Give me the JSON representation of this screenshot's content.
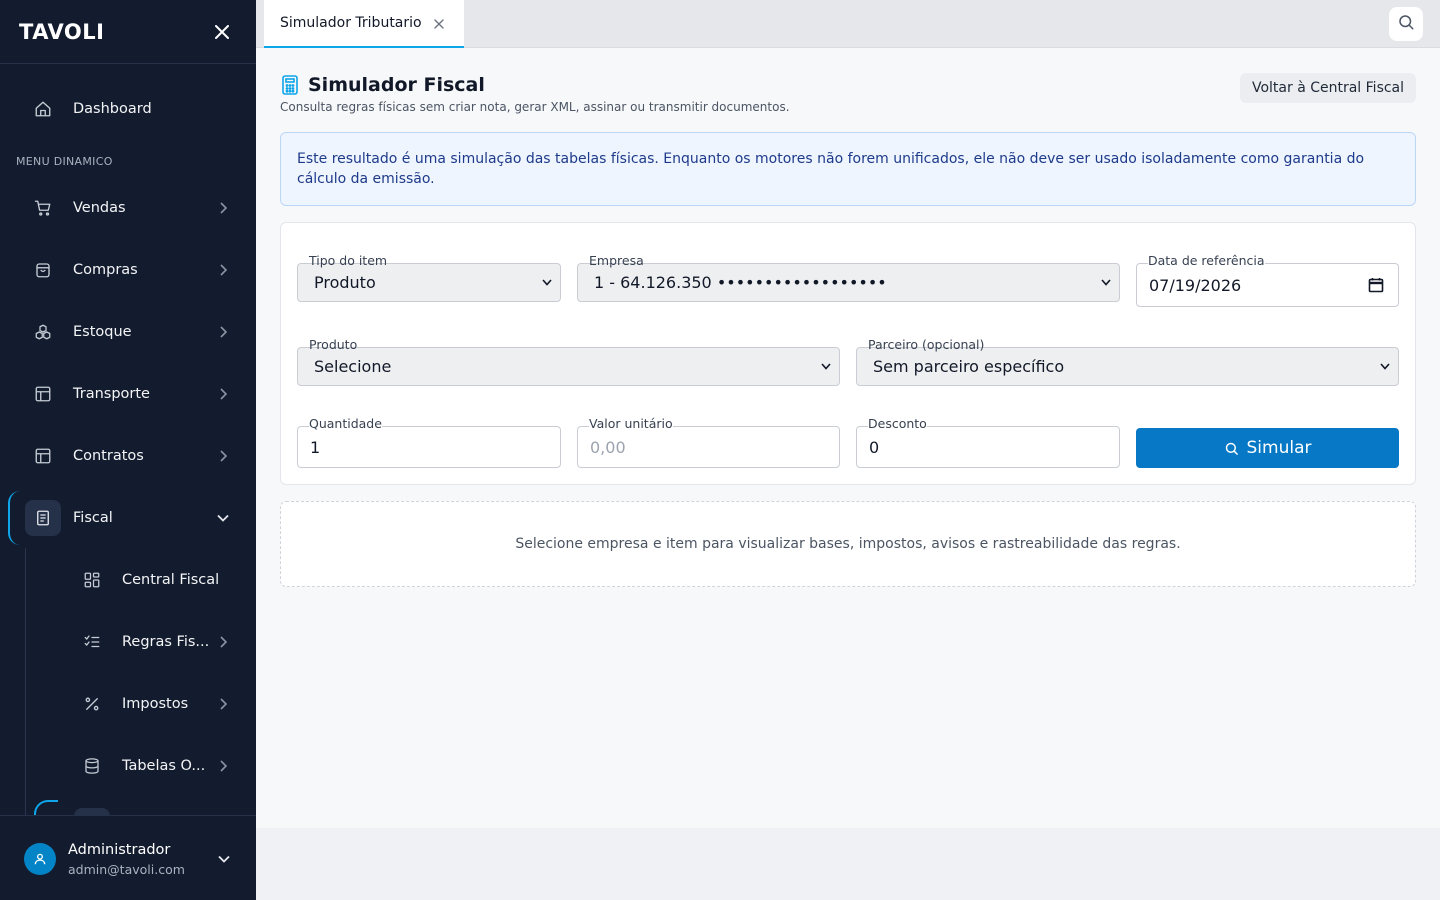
{
  "sidebar": {
    "logo": "TAVOLI",
    "dashboard_label": "Dashboard",
    "section_label": "MENU DINAMICO",
    "items": [
      {
        "label": "Vendas",
        "icon": "cart-icon"
      },
      {
        "label": "Compras",
        "icon": "bag-icon"
      },
      {
        "label": "Estoque",
        "icon": "boxes-icon"
      },
      {
        "label": "Transporte",
        "icon": "layout-icon"
      },
      {
        "label": "Contratos",
        "icon": "layout-icon"
      },
      {
        "label": "Fiscal",
        "icon": "document-icon"
      }
    ],
    "fiscal_sub": [
      {
        "label": "Central Fiscal",
        "icon": "grid-icon"
      },
      {
        "label": "Regras Fis...",
        "icon": "checklist-icon"
      },
      {
        "label": "Impostos",
        "icon": "percent-icon"
      },
      {
        "label": "Tabelas O...",
        "icon": "database-icon"
      }
    ],
    "user": {
      "name": "Administrador",
      "email": "admin@tavoli.com"
    }
  },
  "tabs": [
    {
      "label": "Simulador Tributario"
    }
  ],
  "page": {
    "title": "Simulador Fiscal",
    "subtitle": "Consulta regras físicas sem criar nota, gerar XML, assinar ou transmitir documentos.",
    "back_button": "Voltar à Central Fiscal",
    "notice": "Este resultado é uma simulação das tabelas físicas. Enquanto os motores não forem unificados, ele não deve ser usado isoladamente como garantia do cálculo da emissão."
  },
  "form": {
    "tipo_label": "Tipo do item",
    "tipo_value": "Produto",
    "empresa_label": "Empresa",
    "empresa_value": "1 - 64.126.350 ••••••••••••••••••",
    "data_label": "Data de referência",
    "data_value": "07/19/2026",
    "produto_label": "Produto",
    "produto_value": "Selecione",
    "parceiro_label": "Parceiro (opcional)",
    "parceiro_value": "Sem parceiro específico",
    "quantidade_label": "Quantidade",
    "quantidade_value": "1",
    "valor_label": "Valor unitário",
    "valor_placeholder": "0,00",
    "desconto_label": "Desconto",
    "desconto_value": "0",
    "simular_label": "Simular"
  },
  "empty_state": "Selecione empresa e item para visualizar bases, impostos, avisos e rastreabilidade das regras.",
  "colors": {
    "sidebar_bg": "#131c2e",
    "accent": "#0ea5e9",
    "primary_button": "#0778c5"
  }
}
